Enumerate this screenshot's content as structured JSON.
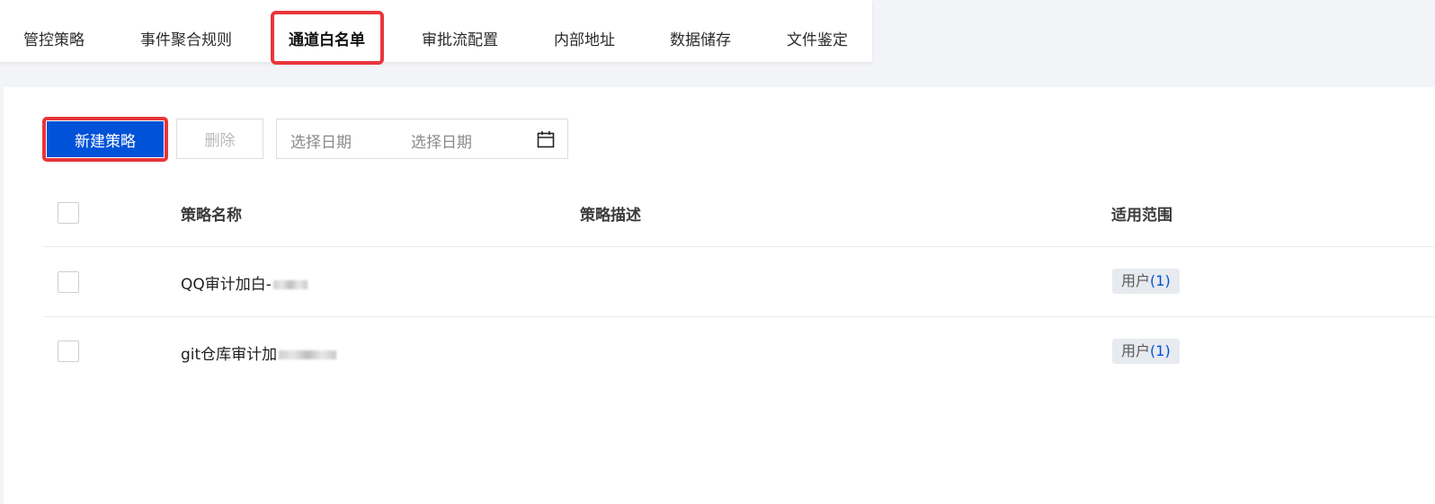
{
  "tabs": [
    {
      "label": "管控策略",
      "active": false
    },
    {
      "label": "事件聚合规则",
      "active": false
    },
    {
      "label": "通道白名单",
      "active": true
    },
    {
      "label": "审批流配置",
      "active": false
    },
    {
      "label": "内部地址",
      "active": false
    },
    {
      "label": "数据储存",
      "active": false
    },
    {
      "label": "文件鉴定",
      "active": false
    }
  ],
  "toolbar": {
    "new_label": "新建策略",
    "delete_label": "删除",
    "date_start_placeholder": "选择日期",
    "date_end_placeholder": "选择日期",
    "calendar_icon": "calendar-icon"
  },
  "table": {
    "columns": [
      "策略名称",
      "策略描述",
      "适用范围"
    ],
    "rows": [
      {
        "name": "QQ审计加白-",
        "description": "",
        "scope_label": "用户",
        "scope_count": "(1)"
      },
      {
        "name": "git仓库审计加",
        "description": "",
        "scope_label": "用户",
        "scope_count": "(1)"
      }
    ]
  },
  "colors": {
    "primary": "#0052d9",
    "highlight": "#e8353b"
  }
}
